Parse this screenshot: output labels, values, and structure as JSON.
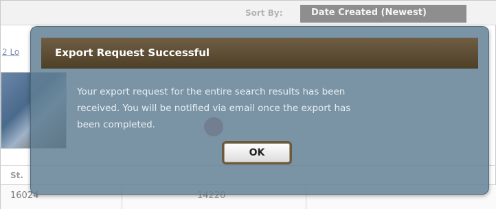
{
  "background": {
    "sort_label": "Sort By:",
    "sort_selected": "Date Created (Newest)",
    "left_link_fragment": "2 Lo",
    "street_fragment": "St.",
    "row_values": [
      "16024",
      "14220"
    ]
  },
  "dialog": {
    "title": "Export Request Successful",
    "message_lines": [
      "Your export request for the entire search results has been",
      "received. You will be notified via email once the export has",
      "been completed."
    ],
    "ok_label": "OK",
    "colors": {
      "header": "#5b4b32",
      "overlay": "#6f8c9f",
      "button_border": "#6b5a3e"
    }
  }
}
